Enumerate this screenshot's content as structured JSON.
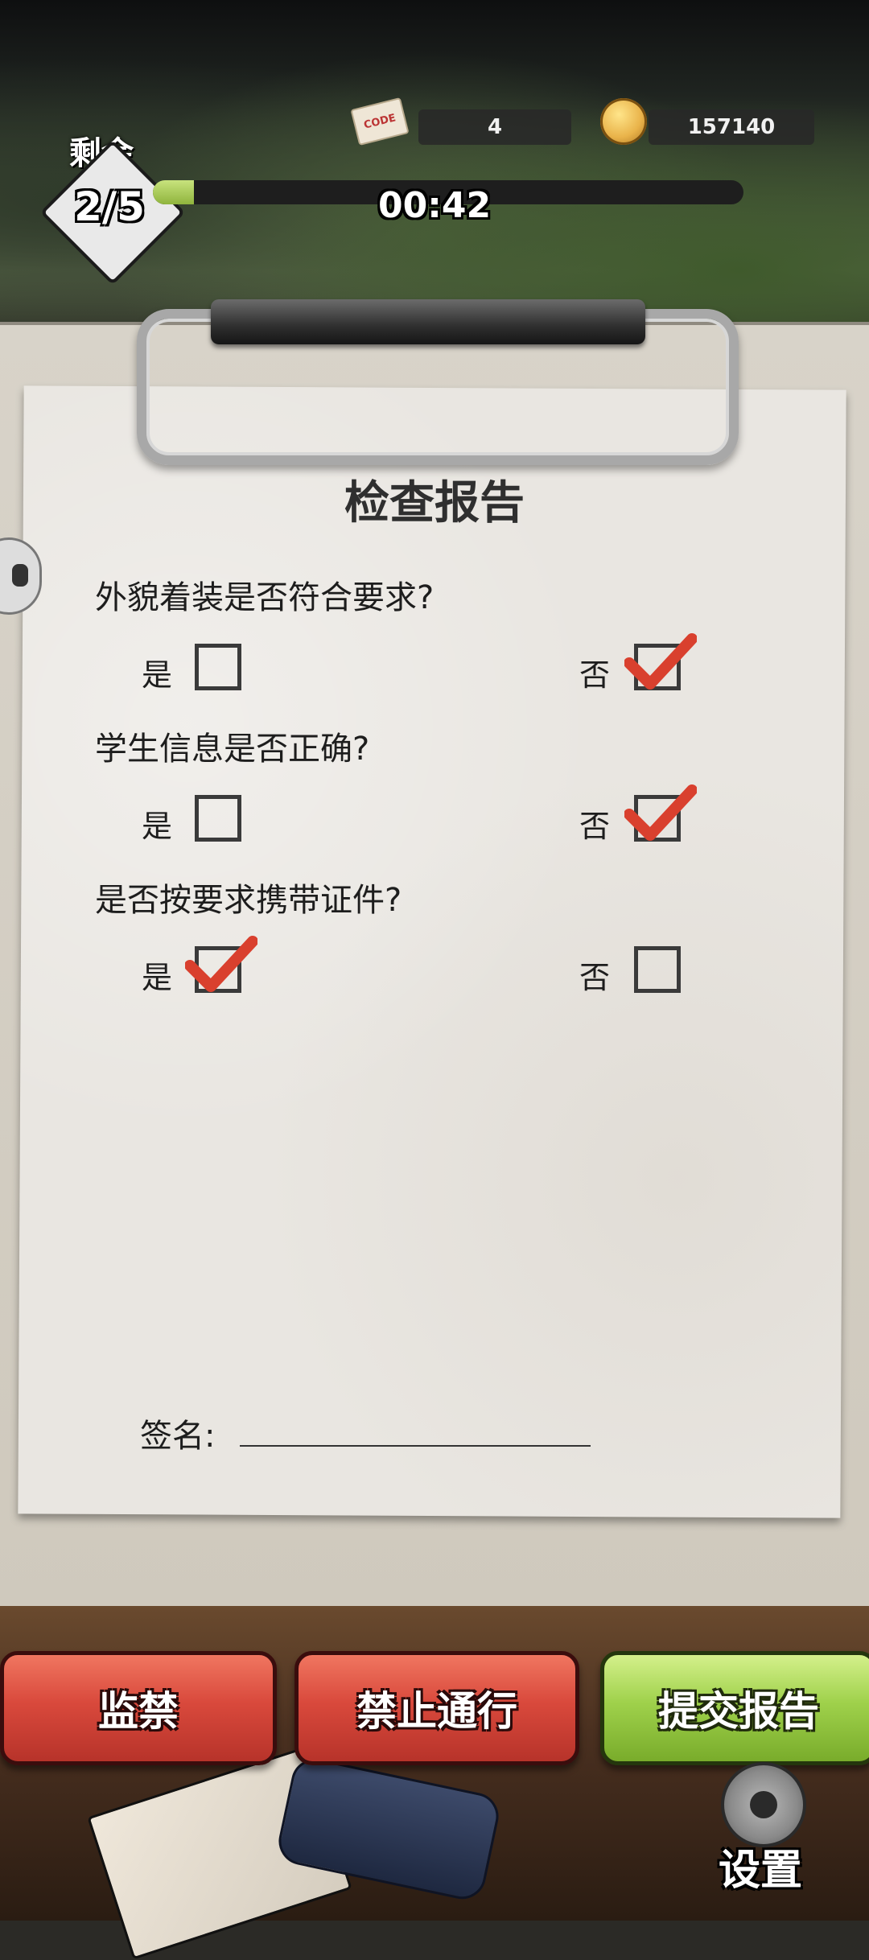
{
  "hud": {
    "code_count": "4",
    "coins": "157140",
    "remaining_label": "剩余",
    "remaining_count": "2/5",
    "progress_fraction": 0.07,
    "timer": "00:42"
  },
  "report": {
    "title": "检查报告",
    "questions": [
      {
        "text": "外貌着装是否符合要求?",
        "yes_label": "是",
        "no_label": "否",
        "checked": "no"
      },
      {
        "text": "学生信息是否正确?",
        "yes_label": "是",
        "no_label": "否",
        "checked": "no"
      },
      {
        "text": "是否按要求携带证件?",
        "yes_label": "是",
        "no_label": "否",
        "checked": "yes"
      }
    ],
    "signature_label": "签名:"
  },
  "actions": {
    "detain": "监禁",
    "deny": "禁止通行",
    "submit": "提交报告",
    "settings": "设置"
  },
  "colors": {
    "check_red": "#d9402e",
    "btn_red": "#d9493c",
    "btn_green": "#9fd14b"
  }
}
